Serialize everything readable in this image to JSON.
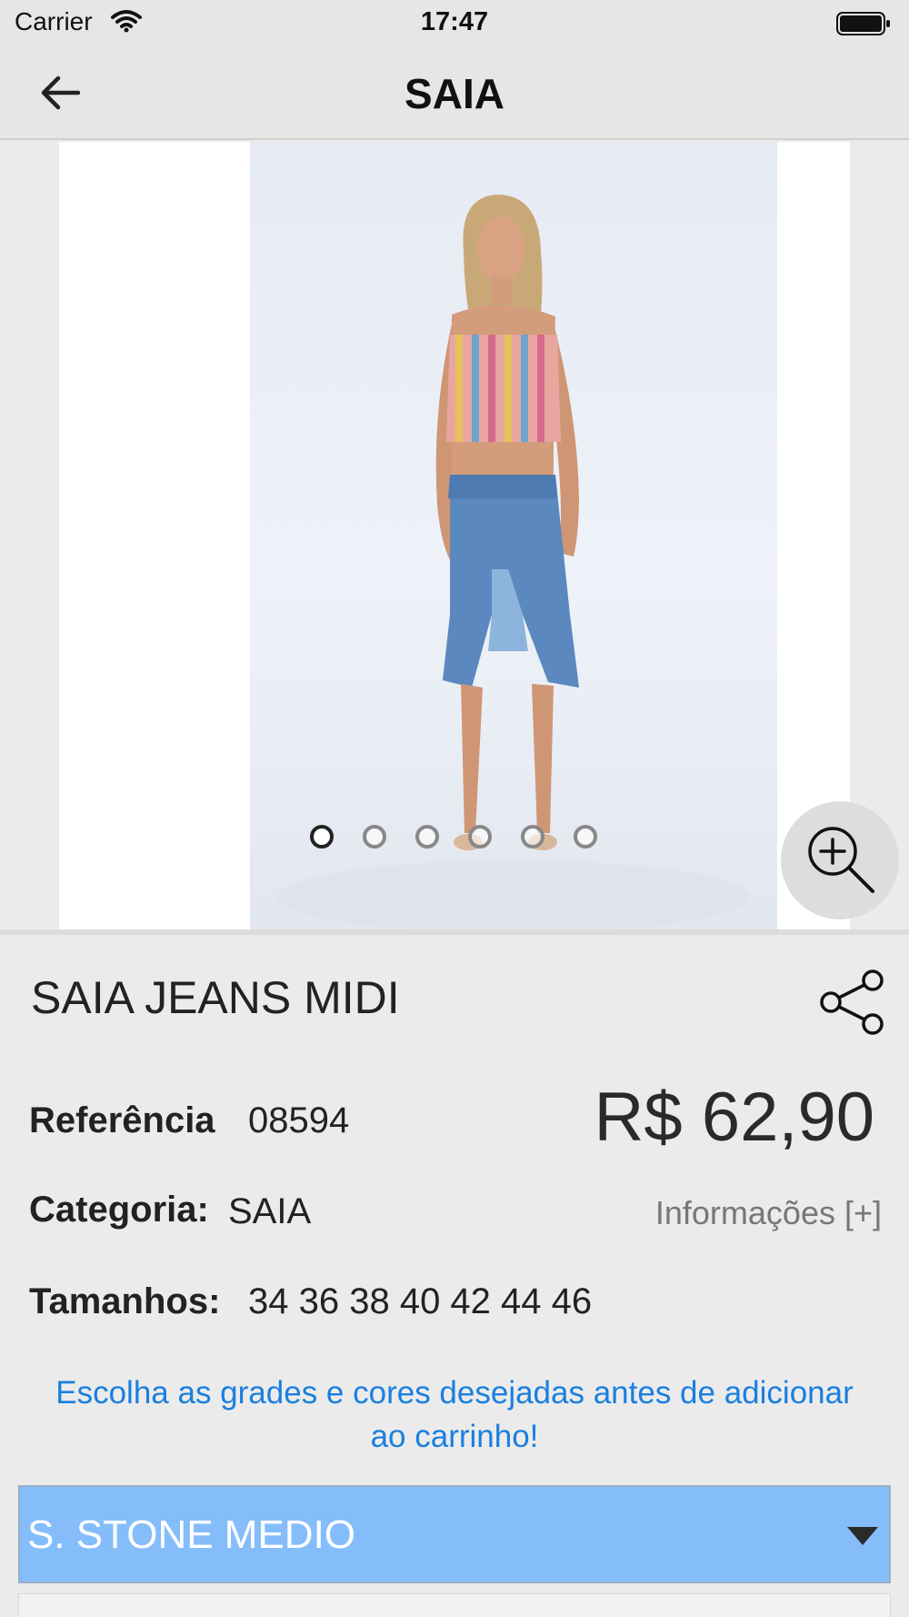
{
  "status_bar": {
    "carrier": "Carrier",
    "time": "17:47",
    "wifi_icon": "wifi-icon",
    "battery_icon": "battery-icon"
  },
  "nav": {
    "title": "SAIA",
    "back_icon": "arrow-left-icon"
  },
  "gallery": {
    "image_count": 6,
    "active_index": 0,
    "zoom_icon": "zoom-in-icon"
  },
  "product": {
    "name": "SAIA JEANS MIDI",
    "share_icon": "share-icon",
    "reference_label": "Referência",
    "reference_value": "08594",
    "price": "R$ 62,90",
    "category_label": "Categoria:",
    "category_value": "SAIA",
    "info_link": "Informações [+]",
    "sizes_label": "Tamanhos:",
    "sizes_value": "34 36 38 40 42 44 46"
  },
  "notice": "Escolha as grades e cores desejadas antes de adicionar ao carrinho!",
  "color_select": {
    "selected": "S. STONE MEDIO",
    "caret_icon": "caret-down-icon"
  },
  "colors": {
    "accent_blue": "#1a7fe0",
    "select_background": "#85bdfb"
  }
}
